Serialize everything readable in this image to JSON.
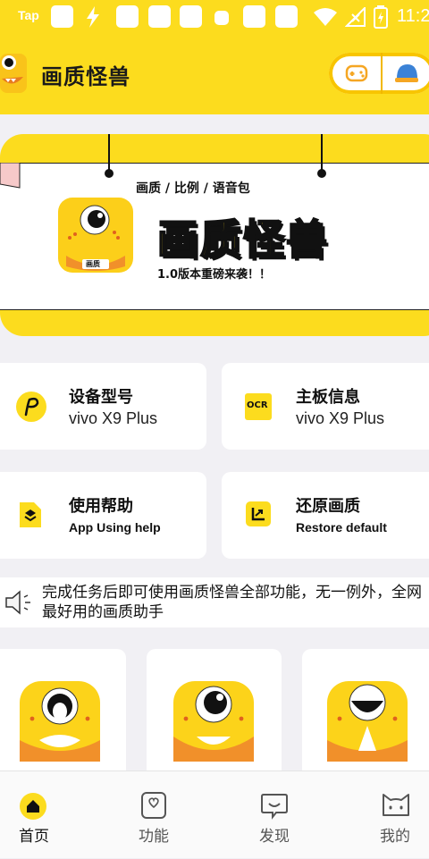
{
  "status_bar": {
    "notification": "Tap",
    "time": "11:2"
  },
  "app_bar": {
    "title": "画质怪兽"
  },
  "banner": {
    "subtitle": "画质 / 比例 / 语音包",
    "big_title": "画质怪兽",
    "tagline": "1.0版本重磅来袭！！",
    "logo_badge": "画质"
  },
  "cards": [
    {
      "title": "设备型号",
      "subtitle": "vivo X9 Plus",
      "icon": "p-logo-icon"
    },
    {
      "title": "主板信息",
      "subtitle": "vivo X9 Plus",
      "icon": "ocr-icon",
      "icon_text": "OCR"
    },
    {
      "title": "使用帮助",
      "subtitle": "App Using help",
      "icon": "layers-doc-icon"
    },
    {
      "title": "还原画质",
      "subtitle": "Restore default",
      "icon": "restore-chart-icon"
    }
  ],
  "notice": {
    "text": "完成任务后即可使用画质怪兽全部功能，无一例外，全网最好用的画质助手"
  },
  "tabs": [
    {
      "label": "首页",
      "icon": "home-icon",
      "active": true
    },
    {
      "label": "功能",
      "icon": "function-heart-icon",
      "active": false
    },
    {
      "label": "发现",
      "icon": "discover-chat-icon",
      "active": false
    },
    {
      "label": "我的",
      "icon": "profile-cat-icon",
      "active": false
    }
  ],
  "colors": {
    "brand_yellow": "#fcdc1e",
    "background": "#f1f0f4",
    "accent_orange": "#f5a623"
  }
}
